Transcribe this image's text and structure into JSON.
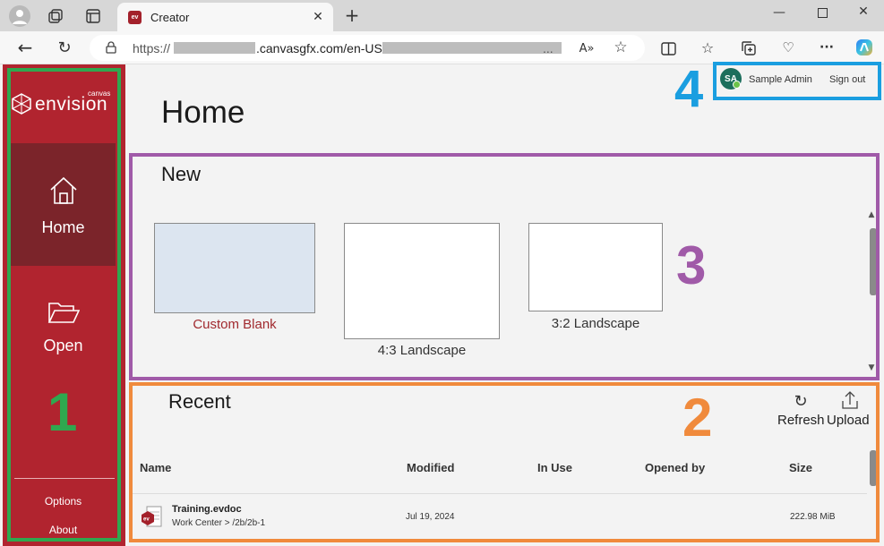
{
  "browser": {
    "tab_title": "Creator",
    "favicon_text": "ev",
    "url_prefix": "https://",
    "url_middle": ".canvasgfx.com/en-US/",
    "url_suffix": "..."
  },
  "sidebar": {
    "logo_small": "canvas",
    "logo_text": "envision",
    "items": [
      {
        "label": "Home",
        "active": true
      },
      {
        "label": "Open",
        "active": false
      }
    ],
    "options_label": "Options",
    "about_label": "About"
  },
  "user": {
    "initials": "SA",
    "name": "Sample Admin",
    "sign_out": "Sign out"
  },
  "main": {
    "title": "Home",
    "new": {
      "heading": "New",
      "templates": [
        {
          "label": "Custom Blank"
        },
        {
          "label": "4:3 Landscape"
        },
        {
          "label": "3:2 Landscape"
        }
      ]
    },
    "recent": {
      "heading": "Recent",
      "refresh_label": "Refresh",
      "upload_label": "Upload",
      "columns": [
        "Name",
        "Modified",
        "In Use",
        "Opened by",
        "Size"
      ],
      "rows": [
        {
          "name": "Training.evdoc",
          "path": "Work Center > /2b/2b-1",
          "modified": "Jul 19, 2024",
          "in_use": "",
          "opened_by": "",
          "size": "222.98 MiB"
        }
      ]
    }
  },
  "annotations": {
    "labels": [
      "1",
      "2",
      "3",
      "4"
    ],
    "colors": {
      "sidebar": "#2fa84f",
      "recent": "#f08a3c",
      "new": "#a05aa8",
      "user": "#1a9ee0"
    }
  },
  "colors": {
    "brand": "#b1242f",
    "brand_dark": "#7b242a"
  }
}
